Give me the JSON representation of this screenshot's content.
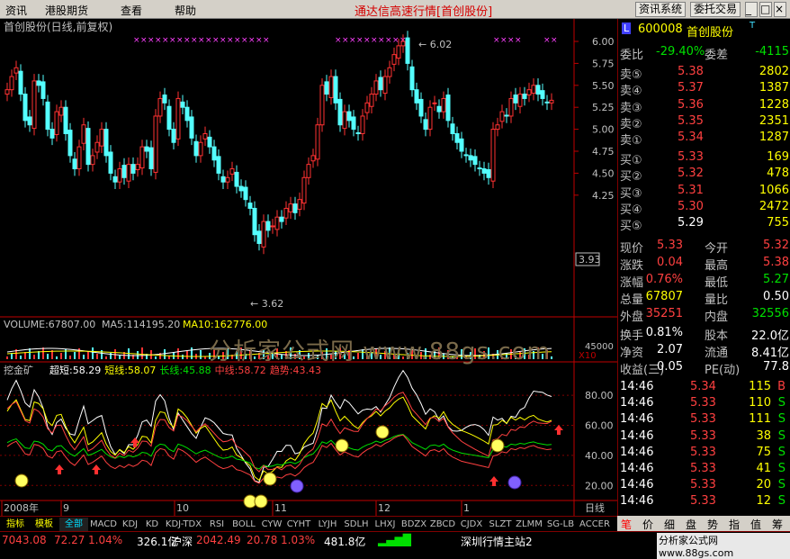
{
  "menu": {
    "items": [
      "资讯",
      "港股期货",
      "查看",
      "帮助"
    ],
    "title": "通达信高速行情",
    "subtitle": "[首创股份]",
    "right_buttons": [
      "资讯系统",
      "委托交易"
    ]
  },
  "chart_header": "首创股份(日线,前复权)",
  "price_axis": [
    "6.00",
    "5.75",
    "5.50",
    "5.25",
    "5.00",
    "4.75",
    "4.50",
    "4.25"
  ],
  "price_current_tag": "3.93",
  "annot_high": "6.02",
  "annot_low": "3.62",
  "volume_header": {
    "label": "VOLUME:67807.00",
    "ma5": "MA5:114195.20",
    "ma10": "MA10:162776.00"
  },
  "volume_axis": {
    "top": "45000",
    "unit": "X10"
  },
  "indicator_header": {
    "name": "挖金矿",
    "items": [
      {
        "text": "超短:58.29",
        "color": "#ffffff"
      },
      {
        "text": "短线:58.07",
        "color": "#ffff00"
      },
      {
        "text": "长线:45.88",
        "color": "#00e000"
      },
      {
        "text": "中线:58.72",
        "color": "#ff4040"
      },
      {
        "text": "趋势:43.43",
        "color": "#ff4040"
      }
    ]
  },
  "indicator_axis": [
    "80.00",
    "60.00",
    "40.00",
    "20.00"
  ],
  "date_axis": [
    "2008年",
    "9",
    "10",
    "11",
    "12",
    "1"
  ],
  "period_label": "日线",
  "bottom_tabs": [
    "指标",
    "模板",
    "全部",
    "MACD",
    "KDJ",
    "KD",
    "KDJ-TDX",
    "RSI",
    "BOLL",
    "CYW",
    "CYHT",
    "LYJH",
    "SDLH",
    "LHXJ",
    "BDZX",
    "ZBCD",
    "CJDX",
    "SLZT",
    "ZLMM",
    "SG-LB",
    "ACCER"
  ],
  "stock": {
    "code": "600008",
    "name": "首创股份",
    "tag": "T"
  },
  "weibi": {
    "label": "委比",
    "value": "-29.40%",
    "label2": "委差",
    "value2": "-4115"
  },
  "asks": [
    {
      "label": "卖⑤",
      "price": "5.38",
      "vol": "2802"
    },
    {
      "label": "卖④",
      "price": "5.37",
      "vol": "1387"
    },
    {
      "label": "卖③",
      "price": "5.36",
      "vol": "1228"
    },
    {
      "label": "卖②",
      "price": "5.35",
      "vol": "2351"
    },
    {
      "label": "卖①",
      "price": "5.34",
      "vol": "1287"
    }
  ],
  "bids": [
    {
      "label": "买①",
      "price": "5.33",
      "vol": "169"
    },
    {
      "label": "买②",
      "price": "5.32",
      "vol": "478"
    },
    {
      "label": "买③",
      "price": "5.31",
      "vol": "1066"
    },
    {
      "label": "买④",
      "price": "5.30",
      "vol": "2472"
    },
    {
      "label": "买⑤",
      "price": "5.29",
      "vol": "755"
    }
  ],
  "stats": [
    {
      "l1": "现价",
      "v1": "5.33",
      "c1": "red",
      "l2": "今开",
      "v2": "5.32",
      "c2": "red"
    },
    {
      "l1": "涨跌",
      "v1": "0.04",
      "c1": "red",
      "l2": "最高",
      "v2": "5.38",
      "c2": "red"
    },
    {
      "l1": "涨幅",
      "v1": "0.76%",
      "c1": "red",
      "l2": "最低",
      "v2": "5.27",
      "c2": "green"
    },
    {
      "l1": "总量",
      "v1": "67807",
      "c1": "yellow",
      "l2": "量比",
      "v2": "0.50",
      "c2": "white"
    },
    {
      "l1": "外盘",
      "v1": "35251",
      "c1": "red",
      "l2": "内盘",
      "v2": "32556",
      "c2": "green"
    }
  ],
  "fin": [
    {
      "l1": "换手",
      "v1": "0.81%",
      "l2": "股本",
      "v2": "22.0亿"
    },
    {
      "l1": "净资",
      "v1": "2.07",
      "l2": "流通",
      "v2": "8.41亿"
    },
    {
      "l1": "收益(三)",
      "v1": "0.05",
      "l2": "PE(动)",
      "v2": "77.8"
    }
  ],
  "ticks": [
    {
      "time": "14:46",
      "price": "5.34",
      "vol": "115",
      "side": "B"
    },
    {
      "time": "14:46",
      "price": "5.33",
      "vol": "110",
      "side": "S"
    },
    {
      "time": "14:46",
      "price": "5.33",
      "vol": "111",
      "side": "S"
    },
    {
      "time": "14:46",
      "price": "5.33",
      "vol": "38",
      "side": "S"
    },
    {
      "time": "14:46",
      "price": "5.33",
      "vol": "75",
      "side": "S"
    },
    {
      "time": "14:46",
      "price": "5.33",
      "vol": "41",
      "side": "S"
    },
    {
      "time": "14:46",
      "price": "5.33",
      "vol": "20",
      "side": "S"
    },
    {
      "time": "14:46",
      "price": "5.33",
      "vol": "12",
      "side": "S"
    }
  ],
  "right_tabs": [
    "笔",
    "价",
    "细",
    "盘",
    "势",
    "指",
    "值",
    "筹"
  ],
  "status": [
    {
      "text": "7043.08",
      "color": "#ff4040"
    },
    {
      "text": "72.27",
      "color": "#ff4040"
    },
    {
      "text": "1.04%",
      "color": "#ff4040"
    },
    {
      "text": "326.1亿",
      "color": "#ffffff"
    },
    {
      "text": "沪深",
      "color": "#ffffff"
    },
    {
      "text": "2042.49",
      "color": "#ff4040"
    },
    {
      "text": "20.78",
      "color": "#ff4040"
    },
    {
      "text": "1.03%",
      "color": "#ff4040"
    },
    {
      "text": "481.8亿",
      "color": "#ffffff"
    },
    {
      "text": "深圳行情主站2",
      "color": "#ffffff"
    }
  ],
  "watermark": "分析家公式网 www.88gs.com",
  "watermark2": "分析家公式网 www.88gs.com",
  "colors": {
    "up": "#ff3232",
    "down": "#54ffff",
    "grid": "#800000",
    "axis": "#c00000"
  },
  "chart_data": {
    "type": "candlestick",
    "title": "首创股份(日线,前复权)",
    "ylim": [
      3.5,
      6.1
    ],
    "high": 6.02,
    "low": 3.62,
    "last_close": 5.33,
    "ma5_volume": 114195.2,
    "ma10_volume": 162776.0
  }
}
